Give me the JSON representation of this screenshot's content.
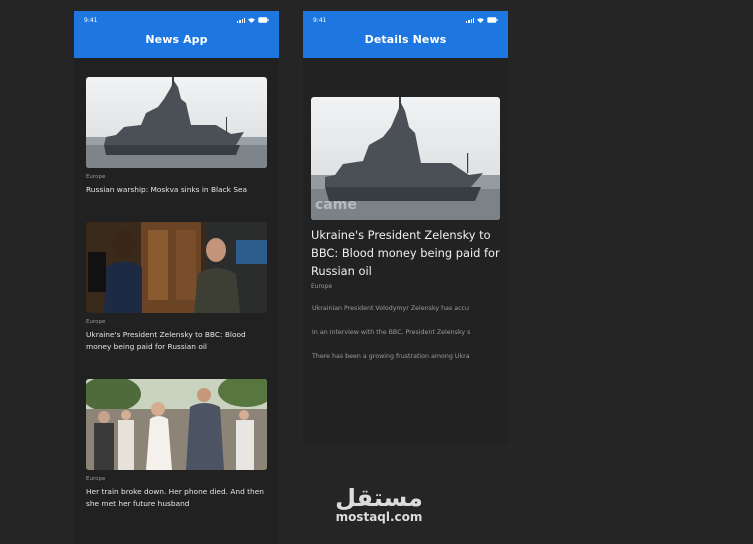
{
  "status": {
    "time": "9:41"
  },
  "list_screen": {
    "title": "News App",
    "articles": [
      {
        "category": "Europe",
        "headline": "Russian warship: Moskva sinks in Black Sea"
      },
      {
        "category": "Europe",
        "headline": "Ukraine's President Zelensky to BBC: Blood money being paid for Russian oil"
      },
      {
        "category": "Europe",
        "headline": "Her train broke down. Her phone died. And then she met her future husband"
      }
    ]
  },
  "detail_screen": {
    "title": "Details News",
    "headline": "Ukraine's President Zelensky to BBC: Blood money being paid for Russian oil",
    "category": "Europe",
    "paragraphs": [
      "Ukrainian President Volodymyr Zelensky has accu",
      "In an interview with the BBC, President Zelensky s",
      "There has been a growing frustration among Ukra"
    ],
    "image_watermark": "came"
  },
  "watermark": {
    "arabic": "مستقل",
    "latin": "mostaql.com"
  },
  "colors": {
    "app_bar": "#1e76e0",
    "background": "#252525",
    "card": "#212121"
  }
}
